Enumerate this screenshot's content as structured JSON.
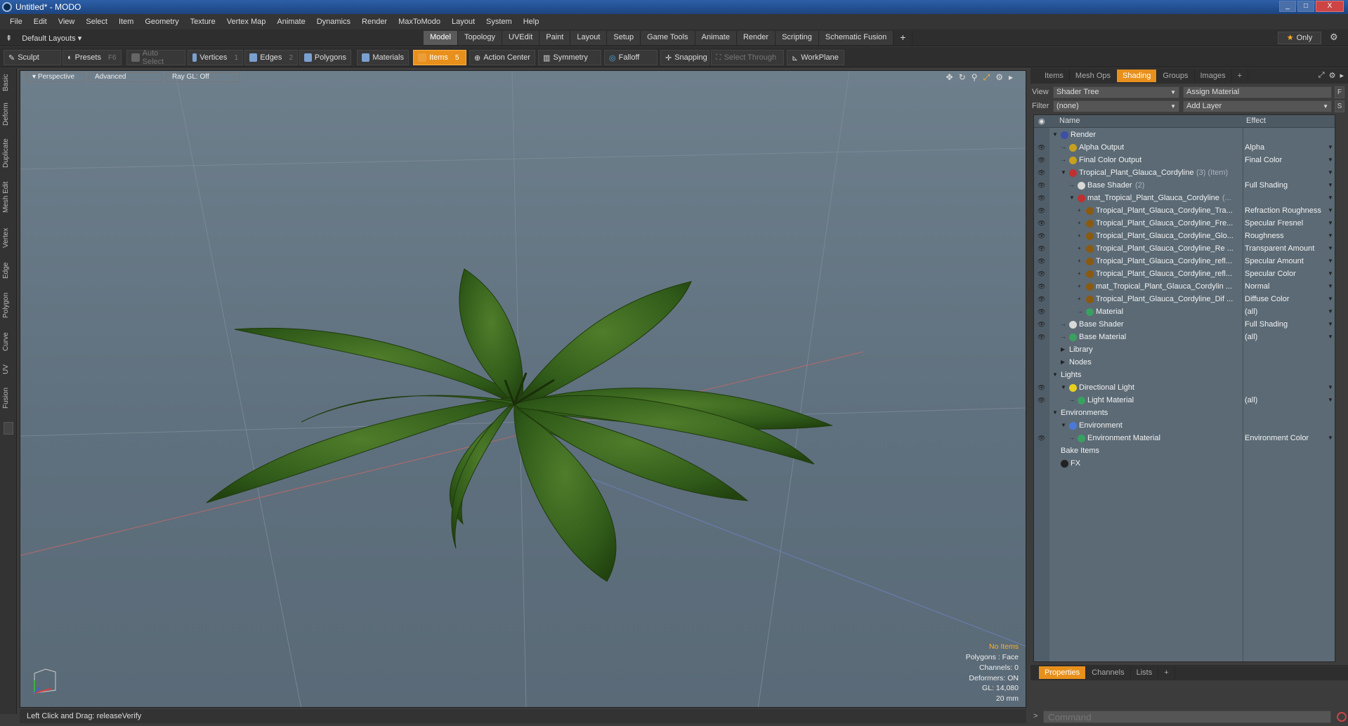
{
  "window": {
    "title": "Untitled* - MODO",
    "controls": [
      "_",
      "□",
      "X"
    ]
  },
  "menu": [
    "File",
    "Edit",
    "View",
    "Select",
    "Item",
    "Geometry",
    "Texture",
    "Vertex Map",
    "Animate",
    "Dynamics",
    "Render",
    "MaxToModo",
    "Layout",
    "System",
    "Help"
  ],
  "layoutbar": {
    "layouts_label": "Default Layouts",
    "tabs": [
      "Model",
      "Topology",
      "UVEdit",
      "Paint",
      "Layout",
      "Setup",
      "Game Tools",
      "Animate",
      "Render",
      "Scripting",
      "Schematic Fusion"
    ],
    "active_tab": "Model",
    "only_label": "Only"
  },
  "toolbar": {
    "sculpt": "Sculpt",
    "presets": "Presets",
    "presets_key": "F6",
    "auto_select": "Auto Select",
    "vertices": "Vertices",
    "vertices_key": "1",
    "edges": "Edges",
    "edges_key": "2",
    "polygons": "Polygons",
    "materials": "Materials",
    "items": "Items",
    "items_key": "5",
    "action_center": "Action Center",
    "symmetry": "Symmetry",
    "falloff": "Falloff",
    "snapping": "Snapping",
    "select_through": "Select Through",
    "workplane": "WorkPlane"
  },
  "left_tabs": [
    "Basic",
    "Deform",
    "Duplicate",
    "Mesh Edit",
    "Vertex",
    "Edge",
    "Polygon",
    "Curve",
    "UV",
    "Fusion"
  ],
  "viewport": {
    "view": "Perspective",
    "shading": "Advanced",
    "raygl": "Ray GL: Off",
    "info": {
      "selection": "No Items",
      "polygons": "Polygons : Face",
      "channels": "Channels: 0",
      "deformers": "Deformers: ON",
      "gl": "GL: 14,080",
      "scale": "20 mm"
    }
  },
  "status": {
    "text": "Left Click and Drag:   releaseVerify"
  },
  "right_panel": {
    "tabs": [
      "Items",
      "Mesh Ops",
      "Shading",
      "Groups",
      "Images",
      "+"
    ],
    "active_tab": "Shading",
    "view_label": "View",
    "view_value": "Shader Tree",
    "assign_material": "Assign Material",
    "filter_label": "Filter",
    "filter_value": "(none)",
    "add_layer": "Add Layer",
    "f_btn": "F",
    "s_btn": "S",
    "col_name": "Name",
    "col_effect": "Effect",
    "rows": [
      {
        "indent": 0,
        "twirl": "▼",
        "icon": "#3d4fa8",
        "name": "Render",
        "extra": "",
        "effect": "",
        "eye": false
      },
      {
        "indent": 1,
        "twirl": "→",
        "icon": "#c8a020",
        "name": "Alpha Output",
        "extra": "",
        "effect": "Alpha",
        "eye": true
      },
      {
        "indent": 1,
        "twirl": "→",
        "icon": "#c8a020",
        "name": "Final Color Output",
        "extra": "",
        "effect": "Final Color",
        "eye": true
      },
      {
        "indent": 1,
        "twirl": "▼",
        "icon": "#c03030",
        "name": "Tropical_Plant_Glauca_Cordyline",
        "extra": "(3) (Item)",
        "effect": "",
        "eye": true
      },
      {
        "indent": 2,
        "twirl": "→",
        "icon": "#d8d8d8",
        "name": "Base Shader",
        "extra": "(2)",
        "effect": "Full Shading",
        "eye": true
      },
      {
        "indent": 2,
        "twirl": "▼",
        "icon": "#c03030",
        "name": "mat_Tropical_Plant_Glauca_Cordyline",
        "extra": "(...",
        "effect": "",
        "eye": true
      },
      {
        "indent": 3,
        "twirl": "+",
        "icon": "#8a5a10",
        "name": "Tropical_Plant_Glauca_Cordyline_Tra...",
        "extra": "",
        "effect": "Refraction Roughness",
        "eye": true
      },
      {
        "indent": 3,
        "twirl": "+",
        "icon": "#8a5a10",
        "name": "Tropical_Plant_Glauca_Cordyline_Fre...",
        "extra": "",
        "effect": "Specular Fresnel",
        "eye": true
      },
      {
        "indent": 3,
        "twirl": "+",
        "icon": "#8a5a10",
        "name": "Tropical_Plant_Glauca_Cordyline_Glo...",
        "extra": "",
        "effect": "Roughness",
        "eye": true
      },
      {
        "indent": 3,
        "twirl": "+",
        "icon": "#8a5a10",
        "name": "Tropical_Plant_Glauca_Cordyline_Re ...",
        "extra": "",
        "effect": "Transparent Amount",
        "eye": true
      },
      {
        "indent": 3,
        "twirl": "+",
        "icon": "#8a5a10",
        "name": "Tropical_Plant_Glauca_Cordyline_refl...",
        "extra": "",
        "effect": "Specular Amount",
        "eye": true
      },
      {
        "indent": 3,
        "twirl": "+",
        "icon": "#8a5a10",
        "name": "Tropical_Plant_Glauca_Cordyline_refl...",
        "extra": "",
        "effect": "Specular Color",
        "eye": true
      },
      {
        "indent": 3,
        "twirl": "+",
        "icon": "#8a5a10",
        "name": "mat_Tropical_Plant_Glauca_Cordylin ...",
        "extra": "",
        "effect": "Normal",
        "eye": true
      },
      {
        "indent": 3,
        "twirl": "+",
        "icon": "#8a5a10",
        "name": "Tropical_Plant_Glauca_Cordyline_Dif ...",
        "extra": "",
        "effect": "Diffuse Color",
        "eye": true
      },
      {
        "indent": 3,
        "twirl": "→",
        "icon": "#3aa060",
        "name": "Material",
        "extra": "",
        "effect": "(all)",
        "eye": true
      },
      {
        "indent": 1,
        "twirl": "→",
        "icon": "#d8d8d8",
        "name": "Base Shader",
        "extra": "",
        "effect": "Full Shading",
        "eye": true
      },
      {
        "indent": 1,
        "twirl": "→",
        "icon": "#3aa060",
        "name": "Base Material",
        "extra": "",
        "effect": "(all)",
        "eye": true
      },
      {
        "indent": 1,
        "twirl": "▶",
        "icon": "",
        "name": "Library",
        "extra": "",
        "effect": "",
        "eye": false
      },
      {
        "indent": 1,
        "twirl": "▶",
        "icon": "",
        "name": "Nodes",
        "extra": "",
        "effect": "",
        "eye": false
      },
      {
        "indent": 0,
        "twirl": "▼",
        "icon": "",
        "name": "Lights",
        "extra": "",
        "effect": "",
        "eye": false
      },
      {
        "indent": 1,
        "twirl": "▼",
        "icon": "#e8d020",
        "name": "Directional Light",
        "extra": "",
        "effect": "",
        "eye": true
      },
      {
        "indent": 2,
        "twirl": "→",
        "icon": "#3aa060",
        "name": "Light Material",
        "extra": "",
        "effect": "(all)",
        "eye": true
      },
      {
        "indent": 0,
        "twirl": "▼",
        "icon": "",
        "name": "Environments",
        "extra": "",
        "effect": "",
        "eye": false
      },
      {
        "indent": 1,
        "twirl": "▼",
        "icon": "#4a7ad8",
        "name": "Environment",
        "extra": "",
        "effect": "",
        "eye": false
      },
      {
        "indent": 2,
        "twirl": "→",
        "icon": "#3aa060",
        "name": "Environment Material",
        "extra": "",
        "effect": "Environment Color",
        "eye": true
      },
      {
        "indent": 0,
        "twirl": "",
        "icon": "",
        "name": "Bake Items",
        "extra": "",
        "effect": "",
        "eye": false
      },
      {
        "indent": 0,
        "twirl": "",
        "icon": "#222222",
        "name": "FX",
        "extra": "",
        "effect": "",
        "eye": false
      }
    ],
    "bottom_tabs": [
      "Properties",
      "Channels",
      "Lists",
      "+"
    ],
    "bottom_active": "Properties",
    "command_placeholder": "Command"
  }
}
